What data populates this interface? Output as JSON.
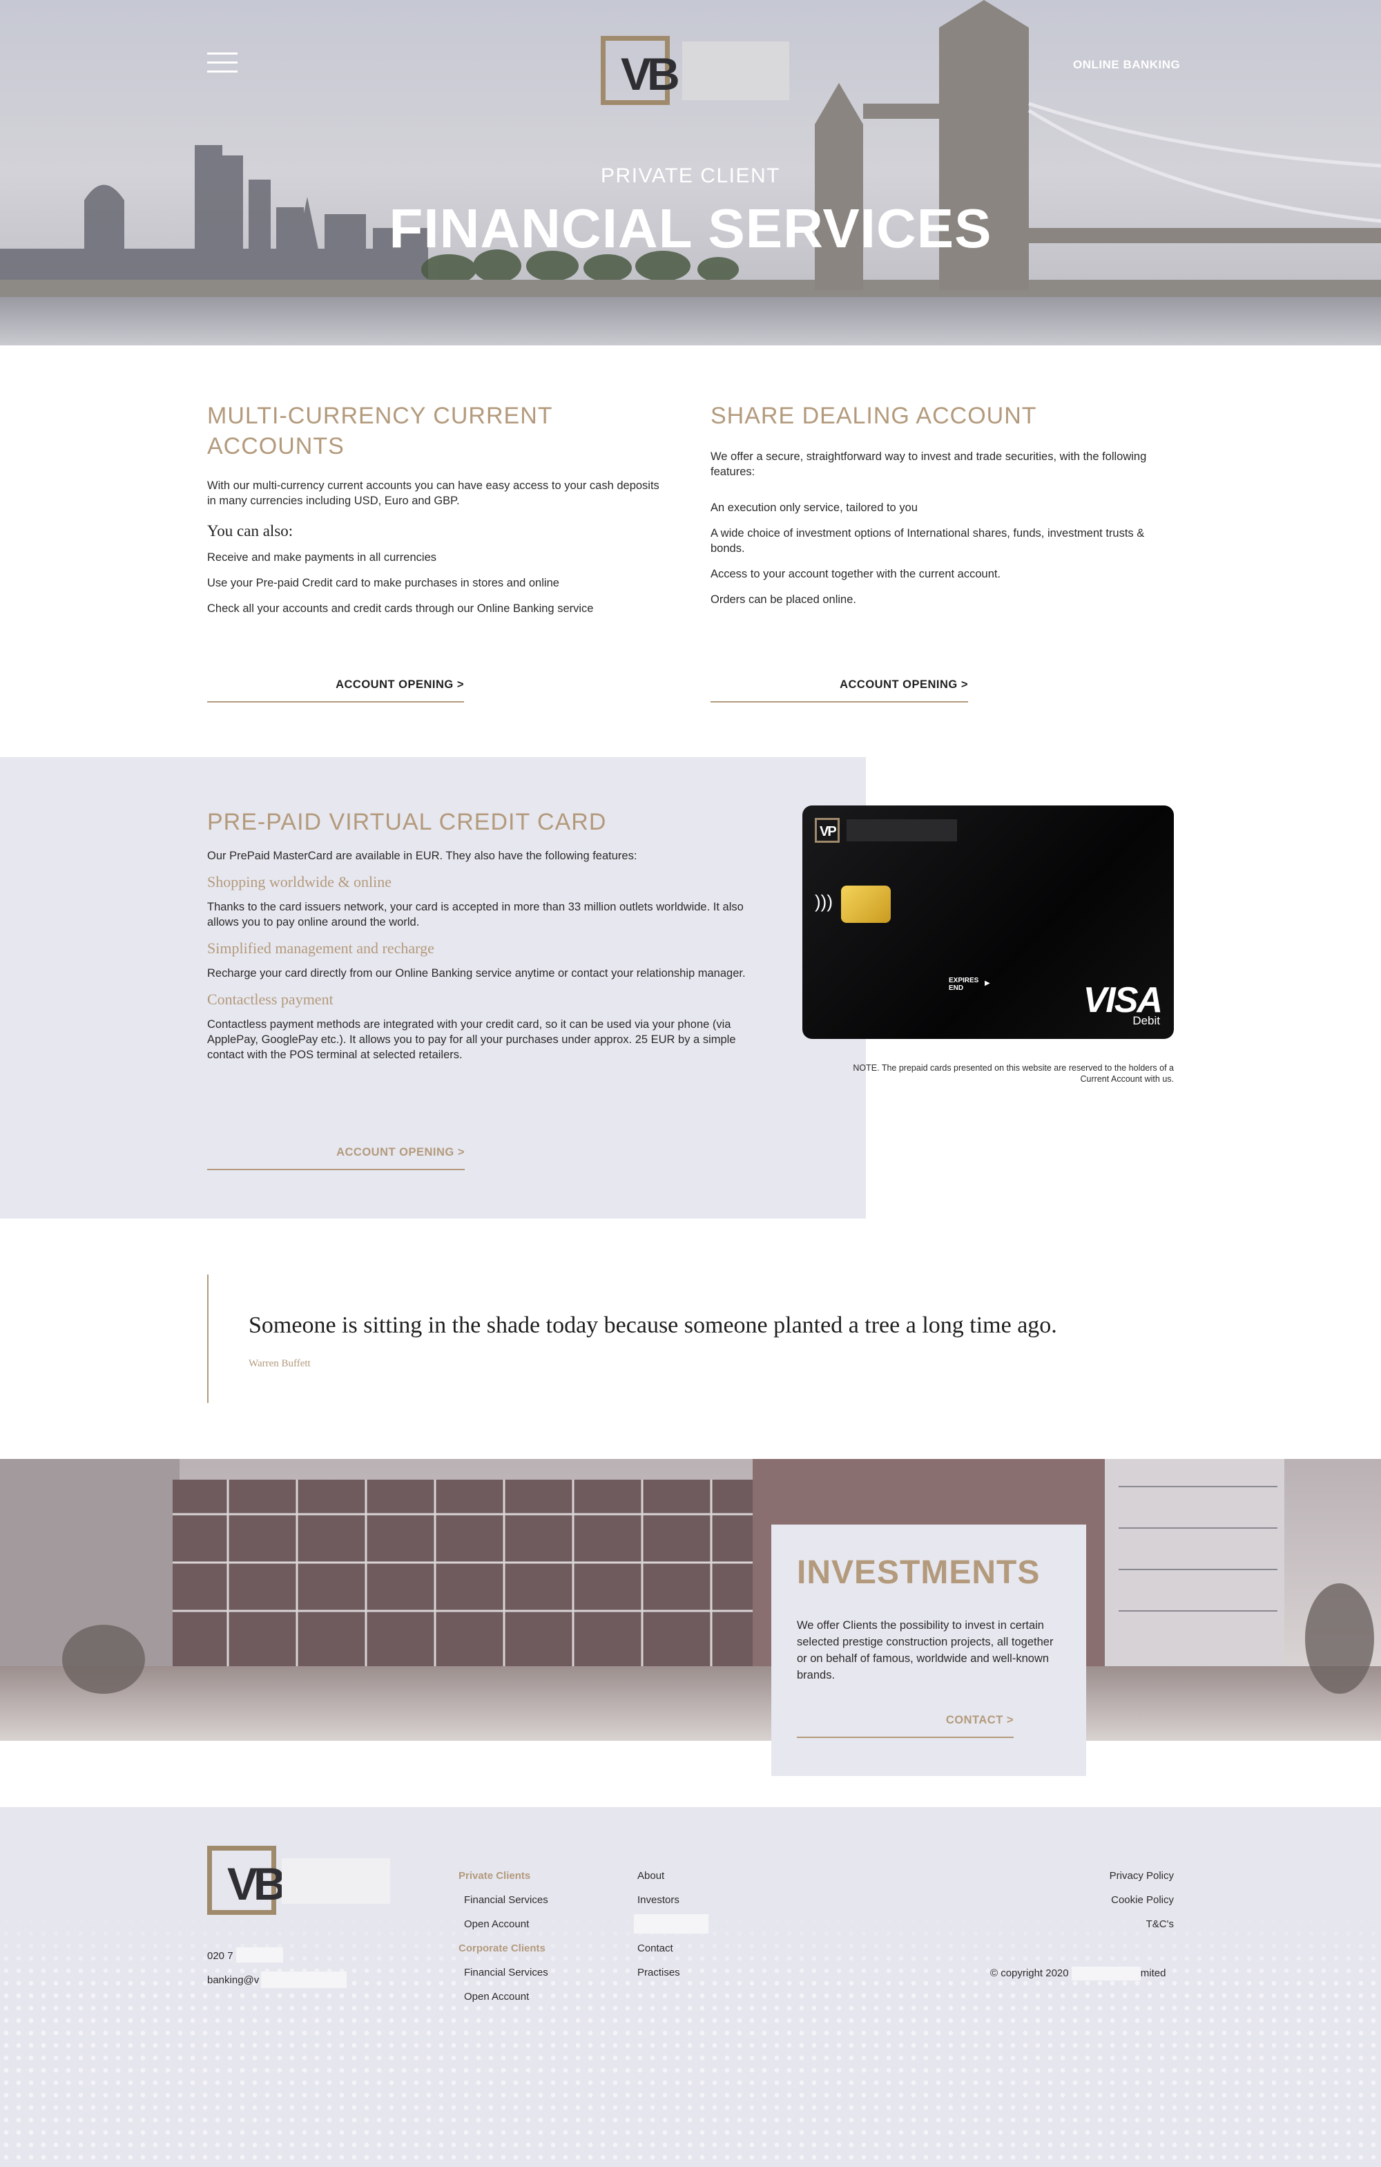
{
  "colors": {
    "accent_gold": "#b39a7c",
    "band_lavender": "#e7e7ef",
    "text_dark": "#2b2b2b"
  },
  "header": {
    "menu_icon": "hamburger-menu-icon",
    "logo_text": "VB",
    "online_banking": "ONLINE BANKING",
    "hero_subtitle": "PRIVATE CLIENT",
    "hero_title": "FINANCIAL SERVICES"
  },
  "multi_currency": {
    "title_line1": "MULTI-CURRENCY CURRENT",
    "title_line2": "ACCOUNTS",
    "intro": "With our multi-currency current accounts you can have easy access to your cash deposits in many currencies including USD, Euro and GBP.",
    "subheading": "You can also:",
    "items": [
      "Receive and make payments in all currencies",
      "Use your Pre-paid Credit card to make purchases in stores and online",
      "Check all your accounts and credit cards through our Online Banking service"
    ],
    "cta": "ACCOUNT OPENING >"
  },
  "share_dealing": {
    "title": "SHARE DEALING ACCOUNT",
    "intro": "We offer a secure, straightforward way to invest and trade securities, with the following features:",
    "items": [
      "An execution only service, tailored to you",
      "A wide choice of investment options of International shares, funds, investment trusts & bonds.",
      "Access to your account together with the current account.",
      "Orders can be placed online."
    ],
    "cta": "ACCOUNT OPENING >"
  },
  "prepaid": {
    "title": "PRE-PAID VIRTUAL CREDIT CARD",
    "intro": "Our PrePaid MasterCard are available in EUR. They also have the following features:",
    "features": [
      {
        "heading": "Shopping worldwide & online",
        "text": "Thanks to the card issuers network, your card is accepted in more than 33 million outlets worldwide. It also allows you to pay online around the world."
      },
      {
        "heading": "Simplified management and recharge",
        "text": "Recharge your card directly from our Online Banking service anytime or contact your relationship manager."
      },
      {
        "heading": "Contactless payment",
        "text": "Contactless payment methods are integrated with your credit card, so it can be used via your phone (via ApplePay, GooglePay etc.). It allows you to pay for all your purchases under approx. 25 EUR by a simple contact with the POS terminal at selected retailers."
      }
    ],
    "cta": "ACCOUNT OPENING >",
    "card": {
      "logo": "VP",
      "expires_line1": "EXPIRES",
      "expires_line2": "END",
      "brand": "VISA",
      "type": "Debit"
    },
    "note": "NOTE. The prepaid cards presented on this website are reserved to the holders of a Current Account with us."
  },
  "quote": {
    "text": "Someone is sitting in the shade today because someone planted a tree a long time ago.",
    "author": "Warren Buffett"
  },
  "investments": {
    "title": "INVESTMENTS",
    "text": "We offer Clients the possibility to invest in certain selected prestige construction projects, all together or on behalf of famous, worldwide and well-known brands.",
    "cta": "CONTACT >"
  },
  "footer": {
    "logo_text": "VB",
    "phone_prefix": "020 7",
    "email_prefix": "banking@v",
    "col1": {
      "private_heading": "Private Clients",
      "private_items": [
        "Financial Services",
        "Open Account"
      ],
      "corporate_heading": "Corporate Clients",
      "corporate_items": [
        "Financial Services",
        "Open Account"
      ]
    },
    "col2": [
      "About",
      "Investors",
      "Contact",
      "Practises"
    ],
    "legal": [
      "Privacy Policy",
      "Cookie Policy",
      "T&C's"
    ],
    "copyright_prefix": "© copyright 2020",
    "copyright_suffix": "mited"
  }
}
